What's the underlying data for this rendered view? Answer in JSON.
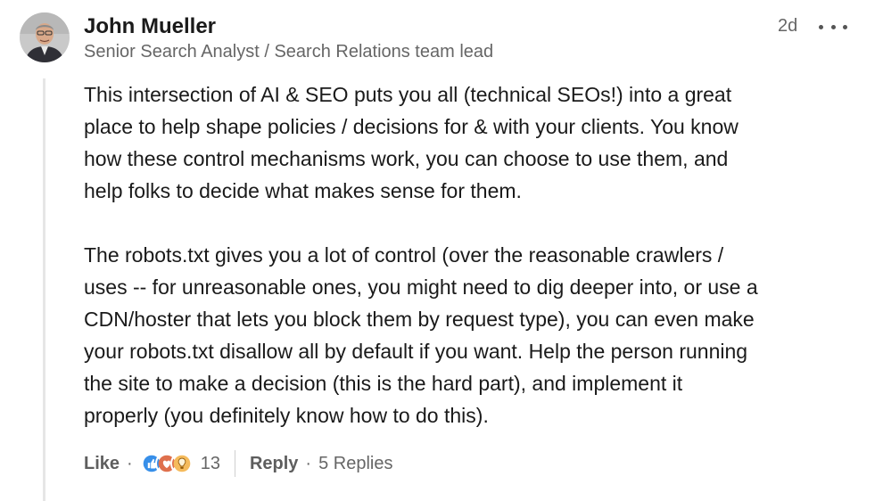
{
  "author": {
    "name": "John Mueller",
    "title": "Senior Search Analyst / Search Relations team lead"
  },
  "post": {
    "timestamp": "2d",
    "paragraphs": [
      "This intersection of AI & SEO puts you all (technical SEOs!) into a great\nplace to help shape policies / decisions for & with your clients. You know\nhow these control mechanisms work, you can choose to use them, and\nhelp folks to decide what makes sense for them.",
      "The robots.txt gives you a lot of control (over the reasonable crawlers /\nuses -- for unreasonable ones, you might need to dig deeper into, or use a\nCDN/hoster that lets you block them by request type), you can even make\nyour robots.txt disallow all by default if you want. Help the person running\nthe site to make a decision (this is the hard part), and implement it\nproperly (you definitely know how to do this)."
    ]
  },
  "actions": {
    "like_label": "Like",
    "separator": "·",
    "reaction_count": "13",
    "reply_label": "Reply",
    "replies_label": "5 Replies"
  },
  "icons": {
    "more": "more-options-icon",
    "reactions": [
      "like-reaction-icon",
      "love-reaction-icon",
      "insightful-reaction-icon"
    ]
  },
  "colors": {
    "like": "#378fe9",
    "love": "#df704d",
    "insightful": "#f5bb5c",
    "muted_text": "#666666"
  }
}
